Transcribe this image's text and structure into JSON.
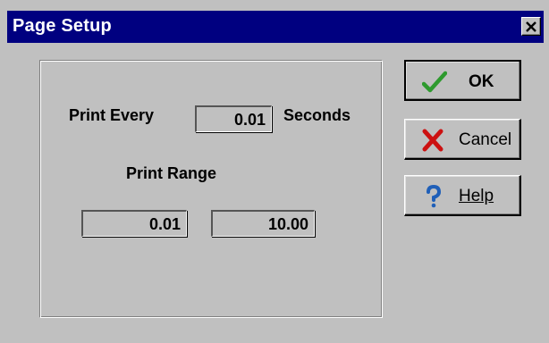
{
  "window": {
    "title": "Page Setup"
  },
  "form": {
    "print_every_label": "Print Every",
    "print_every_value": "0.01",
    "seconds_label": "Seconds",
    "print_range_label": "Print Range",
    "range_start": "0.01",
    "range_end": "10.00"
  },
  "buttons": {
    "ok": {
      "label": "OK",
      "icon": "check-icon"
    },
    "cancel": {
      "label": "Cancel",
      "icon": "x-icon"
    },
    "help": {
      "label": "Help",
      "icon": "question-icon"
    }
  },
  "colors": {
    "titlebar": "#000080",
    "dialog_bg": "#c0c0c0",
    "check": "#2e9a2e",
    "cancel_x": "#cc1111",
    "help_q": "#1f5fb8"
  }
}
